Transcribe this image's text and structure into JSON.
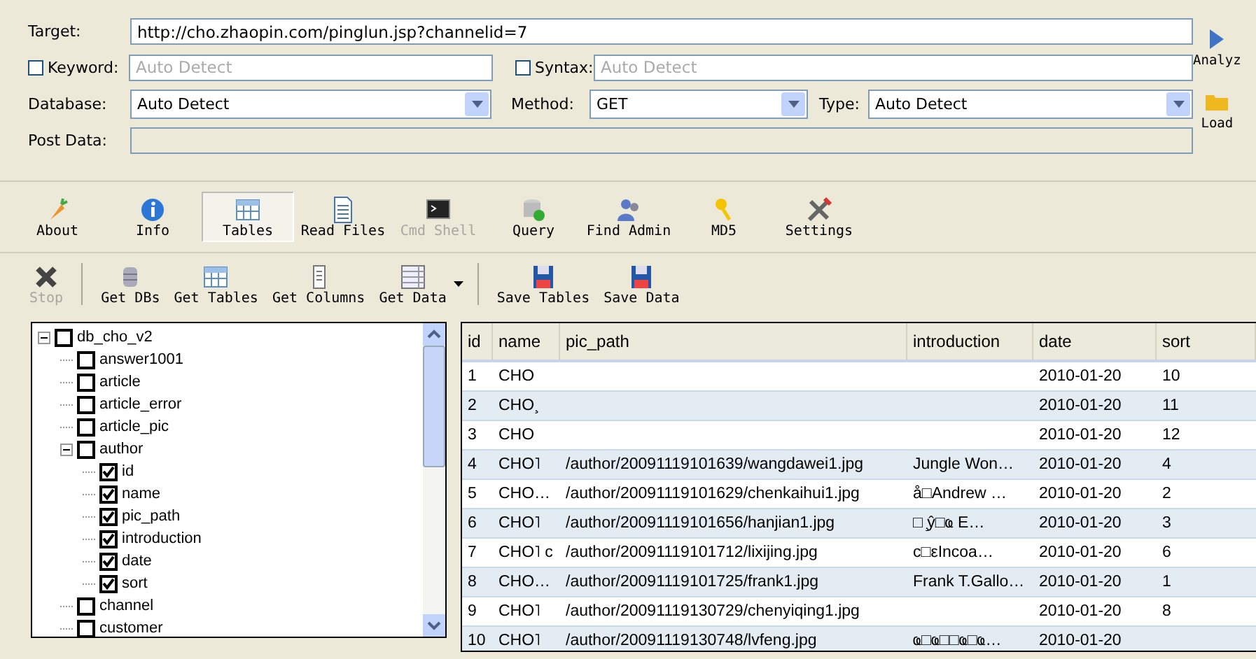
{
  "form": {
    "target_label": "Target:",
    "target_value": "http://cho.zhaopin.com/pinglun.jsp?channelid=7",
    "keyword": {
      "label": "Keyword:",
      "checked": false,
      "placeholder": "Auto Detect"
    },
    "syntax": {
      "label": "Syntax:",
      "checked": false,
      "placeholder": "Auto Detect"
    },
    "database": {
      "label": "Database:",
      "value": "Auto Detect"
    },
    "method": {
      "label": "Method:",
      "value": "GET"
    },
    "type": {
      "label": "Type:",
      "value": "Auto Detect"
    },
    "post_data_label": "Post Data:"
  },
  "side_buttons": [
    {
      "label": "Analyz"
    },
    {
      "label": "Load"
    }
  ],
  "main_toolbar": [
    {
      "label": "About",
      "selected": false,
      "disabled": false
    },
    {
      "label": "Info",
      "selected": false,
      "disabled": false
    },
    {
      "label": "Tables",
      "selected": true,
      "disabled": false
    },
    {
      "label": "Read Files",
      "selected": false,
      "disabled": false
    },
    {
      "label": "Cmd Shell",
      "selected": false,
      "disabled": true
    },
    {
      "label": "Query",
      "selected": false,
      "disabled": false
    },
    {
      "label": "Find Admin",
      "selected": false,
      "disabled": false
    },
    {
      "label": "MD5",
      "selected": false,
      "disabled": false
    },
    {
      "label": "Settings",
      "selected": false,
      "disabled": false
    }
  ],
  "action_toolbar": [
    {
      "label": "Stop",
      "disabled": true
    },
    {
      "label": "Get DBs",
      "disabled": false
    },
    {
      "label": "Get Tables",
      "disabled": false
    },
    {
      "label": "Get Columns",
      "disabled": false
    },
    {
      "label": "Get Data",
      "disabled": false
    },
    {
      "label": "Save Tables",
      "disabled": false
    },
    {
      "label": "Save Data",
      "disabled": false
    }
  ],
  "tree": [
    {
      "label": "db_cho_v2",
      "checked": false,
      "expanded": true,
      "children": [
        {
          "label": "answer1001",
          "checked": false
        },
        {
          "label": "article",
          "checked": false
        },
        {
          "label": "article_error",
          "checked": false
        },
        {
          "label": "article_pic",
          "checked": false
        },
        {
          "label": "author",
          "checked": false,
          "expanded": true,
          "children": [
            {
              "label": "id",
              "checked": true
            },
            {
              "label": "name",
              "checked": true
            },
            {
              "label": "pic_path",
              "checked": true
            },
            {
              "label": "introduction",
              "checked": true
            },
            {
              "label": "date",
              "checked": true
            },
            {
              "label": "sort",
              "checked": true
            }
          ]
        },
        {
          "label": "channel",
          "checked": false
        },
        {
          "label": "customer",
          "checked": false
        }
      ]
    }
  ],
  "table": {
    "columns": [
      "id",
      "name",
      "pic_path",
      "introduction",
      "date",
      "sort"
    ],
    "rows": [
      [
        "1",
        "CHO",
        "",
        "",
        "2010-01-20",
        "10"
      ],
      [
        "2",
        "CHO¸",
        "",
        "",
        "2010-01-20",
        "11"
      ],
      [
        "3",
        "CHO",
        "",
        "",
        "2010-01-20",
        "12"
      ],
      [
        "4",
        "CHO˥",
        "/author/20091119101639/wangdawei1.jpg",
        "Jungle Won…",
        "2010-01-20",
        "4"
      ],
      [
        "5",
        "CHO…",
        "/author/20091119101629/chenkaihui1.jpg",
        "å□Andrew …",
        "2010-01-20",
        "2"
      ],
      [
        "6",
        "CHO˥",
        "/author/20091119101656/hanjian1.jpg",
        "□ ̧ŷ□ҩ E…",
        "2010-01-20",
        "3"
      ],
      [
        "7",
        "CHO˥ c",
        "/author/20091119101712/lixijing.jpg",
        "c□εIncoa…",
        "2010-01-20",
        "6"
      ],
      [
        "8",
        "CHO…",
        "/author/20091119101725/frank1.jpg",
        "Frank T.Gallo…",
        "2010-01-20",
        "1"
      ],
      [
        "9",
        "CHO˥",
        "/author/20091119130729/chenyiqing1.jpg",
        "",
        "2010-01-20",
        "8"
      ],
      [
        "10",
        "CHO˥",
        "/author/20091119130748/lvfeng.jpg",
        "ҩ□ҩ□□ҩ□ҩ…",
        "2010-01-20",
        ""
      ]
    ]
  }
}
